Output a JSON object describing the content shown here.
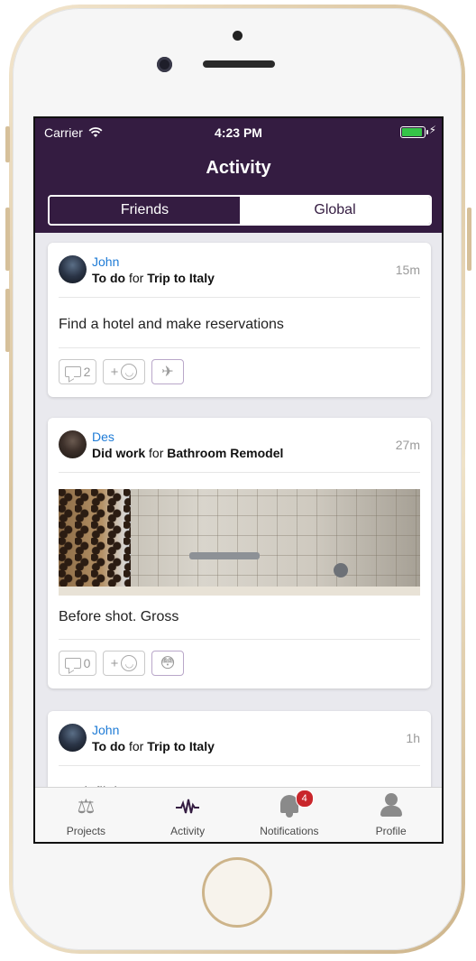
{
  "status": {
    "carrier": "Carrier",
    "time": "4:23 PM"
  },
  "nav": {
    "title": "Activity"
  },
  "segmented": {
    "friends": "Friends",
    "global": "Global"
  },
  "feed": [
    {
      "user": "John",
      "action": "To do",
      "connector": "for",
      "project": "Trip to Italy",
      "time": "15m",
      "text": "Find a hotel and make reservations",
      "comments": "2",
      "reaction_icon": "airplane-icon"
    },
    {
      "user": "Des",
      "action": "Did work",
      "connector": "for",
      "project": "Bathroom Remodel",
      "time": "27m",
      "text": "Before shot. Gross",
      "comments": "0",
      "reaction_icon": "flushed-face-icon"
    },
    {
      "user": "John",
      "action": "To do",
      "connector": "for",
      "project": "Trip to Italy",
      "time": "1h",
      "text": "Book flights"
    }
  ],
  "tabs": [
    {
      "label": "Projects",
      "icon": "scales-icon"
    },
    {
      "label": "Activity",
      "icon": "pulse-icon"
    },
    {
      "label": "Notifications",
      "icon": "bell-icon",
      "badge": "4"
    },
    {
      "label": "Profile",
      "icon": "person-icon"
    }
  ],
  "colors": {
    "brand": "#341c41",
    "link": "#1e7bd6",
    "badge": "#c9262b"
  }
}
